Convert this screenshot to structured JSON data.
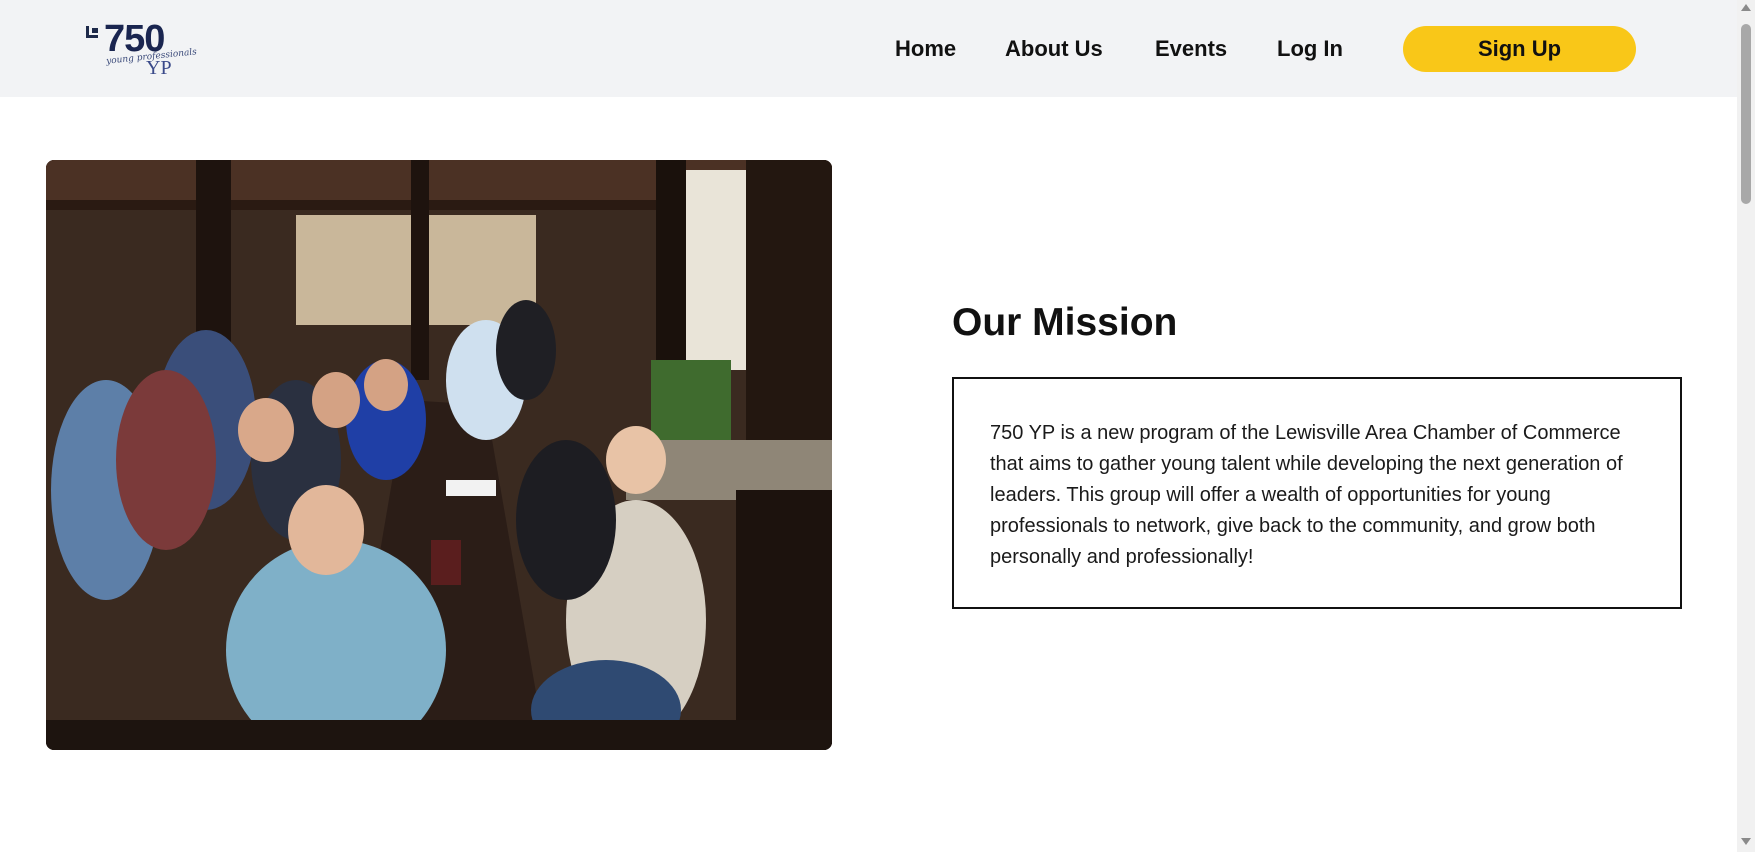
{
  "logo": {
    "number": "750",
    "script_text": "young professionals",
    "suffix": "YP"
  },
  "nav": {
    "home": "Home",
    "about": "About Us",
    "events": "Events",
    "login": "Log In",
    "signup": "Sign Up"
  },
  "colors": {
    "nav_background": "#f2f3f5",
    "signup_button": "#f9c718",
    "text": "#111111",
    "logo_navy": "#1a2550"
  },
  "photo": {
    "description_icon": "group-photo-image"
  },
  "mission": {
    "title": "Our Mission",
    "body": "750 YP is a new program of the Lewisville Area Chamber of Commerce that aims to gather young talent while developing the next generation of leaders. This group will offer a wealth of opportunities for young professionals to network, give back to the community, and grow both personally and professionally!"
  }
}
